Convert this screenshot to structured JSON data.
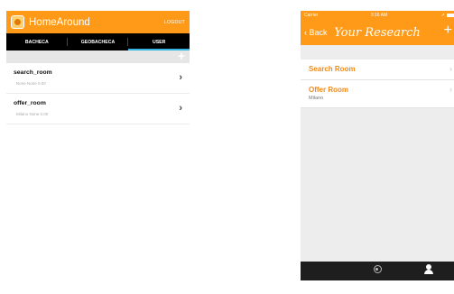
{
  "android": {
    "app_title": "HomeAround",
    "logout_label": "LOGOUT",
    "tabs": [
      {
        "label": "BACHECA"
      },
      {
        "label": "GEOBACHECA"
      },
      {
        "label": "USER"
      }
    ],
    "active_tab": "USER",
    "add_icon": "+",
    "items": [
      {
        "title": "search_room",
        "subtitle": "None None 0.00",
        "chevron": "›"
      },
      {
        "title": "offer_room",
        "subtitle": "Milano None 0.00",
        "chevron": "›"
      }
    ]
  },
  "ios": {
    "status": {
      "carrier": "Carrier",
      "time": "3:16 AM",
      "location": "➚"
    },
    "back_label": "‹ Back",
    "title": "Your Research",
    "add_icon": "+",
    "items": [
      {
        "title": "Search Room",
        "subtitle": "",
        "chevron": "›"
      },
      {
        "title": "Offer Room",
        "subtitle": "Milano",
        "chevron": "›"
      }
    ],
    "tabbar": [
      {
        "icon": "grid-icon"
      },
      {
        "icon": "target-icon"
      },
      {
        "icon": "user-icon"
      }
    ]
  },
  "colors": {
    "accent": "#ff9a18",
    "tab_indicator": "#35b6e5",
    "ios_item_text": "#f08a1c"
  }
}
